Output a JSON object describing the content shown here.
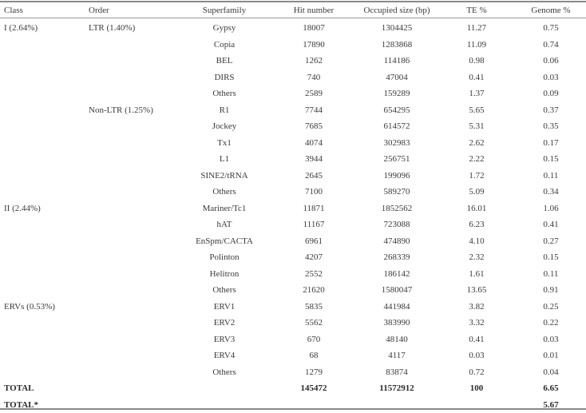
{
  "table": {
    "headers": [
      "Class",
      "Order",
      "Superfamily",
      "Hit number",
      "Occupied size (bp)",
      "TE %",
      "Genome %"
    ],
    "rows": [
      {
        "class": "I (2.64%)",
        "order": "LTR (1.40%)",
        "superfamily": "Gypsy",
        "hit": "18007",
        "size": "1304425",
        "te": "11.27",
        "genome": "0.75"
      },
      {
        "class": "",
        "order": "",
        "superfamily": "Copia",
        "hit": "17890",
        "size": "1283868",
        "te": "11.09",
        "genome": "0.74"
      },
      {
        "class": "",
        "order": "",
        "superfamily": "BEL",
        "hit": "1262",
        "size": "114186",
        "te": "0.98",
        "genome": "0.06"
      },
      {
        "class": "",
        "order": "",
        "superfamily": "DIRS",
        "hit": "740",
        "size": "47004",
        "te": "0.41",
        "genome": "0.03"
      },
      {
        "class": "",
        "order": "",
        "superfamily": "Others",
        "hit": "2589",
        "size": "159289",
        "te": "1.37",
        "genome": "0.09"
      },
      {
        "class": "",
        "order": "Non-LTR (1.25%)",
        "superfamily": "R1",
        "hit": "7744",
        "size": "654295",
        "te": "5.65",
        "genome": "0.37"
      },
      {
        "class": "",
        "order": "",
        "superfamily": "Jockey",
        "hit": "7685",
        "size": "614572",
        "te": "5.31",
        "genome": "0.35"
      },
      {
        "class": "",
        "order": "",
        "superfamily": "Tx1",
        "hit": "4074",
        "size": "302983",
        "te": "2.62",
        "genome": "0.17"
      },
      {
        "class": "",
        "order": "",
        "superfamily": "L1",
        "hit": "3944",
        "size": "256751",
        "te": "2.22",
        "genome": "0.15"
      },
      {
        "class": "",
        "order": "",
        "superfamily": "SINE2/tRNA",
        "hit": "2645",
        "size": "199096",
        "te": "1.72",
        "genome": "0.11"
      },
      {
        "class": "",
        "order": "",
        "superfamily": "Others",
        "hit": "7100",
        "size": "589270",
        "te": "5.09",
        "genome": "0.34"
      },
      {
        "class": "II (2.44%)",
        "order": "",
        "superfamily": "Mariner/Tc1",
        "hit": "11871",
        "size": "1852562",
        "te": "16.01",
        "genome": "1.06"
      },
      {
        "class": "",
        "order": "",
        "superfamily": "hAT",
        "hit": "11167",
        "size": "723088",
        "te": "6.23",
        "genome": "0.41"
      },
      {
        "class": "",
        "order": "",
        "superfamily": "EnSpm/CACTA",
        "hit": "6961",
        "size": "474890",
        "te": "4.10",
        "genome": "0.27"
      },
      {
        "class": "",
        "order": "",
        "superfamily": "Polinton",
        "hit": "4207",
        "size": "268339",
        "te": "2.32",
        "genome": "0.15"
      },
      {
        "class": "",
        "order": "",
        "superfamily": "Helitron",
        "hit": "2552",
        "size": "186142",
        "te": "1.61",
        "genome": "0.11"
      },
      {
        "class": "",
        "order": "",
        "superfamily": "Others",
        "hit": "21620",
        "size": "1580047",
        "te": "13.65",
        "genome": "0.91"
      },
      {
        "class": "ERVs (0.53%)",
        "order": "",
        "superfamily": "ERV1",
        "hit": "5835",
        "size": "441984",
        "te": "3.82",
        "genome": "0.25"
      },
      {
        "class": "",
        "order": "",
        "superfamily": "ERV2",
        "hit": "5562",
        "size": "383990",
        "te": "3.32",
        "genome": "0.22"
      },
      {
        "class": "",
        "order": "",
        "superfamily": "ERV3",
        "hit": "670",
        "size": "48140",
        "te": "0.41",
        "genome": "0.03"
      },
      {
        "class": "",
        "order": "",
        "superfamily": "ERV4",
        "hit": "68",
        "size": "4117",
        "te": "0.03",
        "genome": "0.01"
      },
      {
        "class": "",
        "order": "",
        "superfamily": "Others",
        "hit": "1279",
        "size": "83874",
        "te": "0.72",
        "genome": "0.04"
      }
    ],
    "totals": [
      {
        "class": "TOTAL",
        "order": "",
        "superfamily": "",
        "hit": "145472",
        "size": "11572912",
        "te": "100",
        "genome": "6.65"
      },
      {
        "class": "TOTAL*",
        "order": "",
        "superfamily": "",
        "hit": "",
        "size": "",
        "te": "",
        "genome": "5.67"
      }
    ]
  }
}
